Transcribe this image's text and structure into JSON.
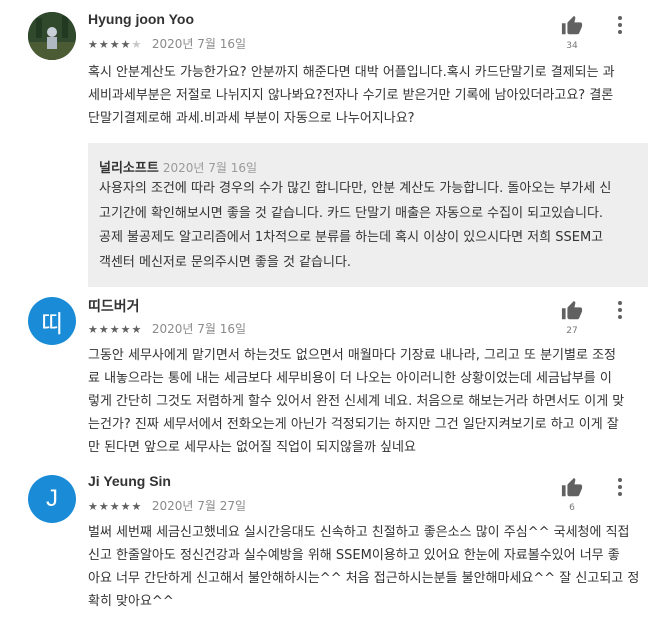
{
  "reviews": [
    {
      "author": "Hyung joon Yoo",
      "rating": 4,
      "date": "2020년 7월 16일",
      "likes": "34",
      "avatar_type": "photo",
      "body_lines": [
        "혹시 안분계산도 가능한가요? 안분까지 해준다면 대박 어플입니다.혹시 카드단말기로 결제되는 과",
        "세비과세부분은 저절로 나뉘지지 않나봐요?전자나 수기로 받은거만 기록에 남아있더라고요? 결론",
        "단말기결제로해 과세.비과세 부분이 자동으로 나누어지나요?"
      ],
      "reply": {
        "author": "널리소프트",
        "date": "2020년 7월 16일",
        "lines": [
          "사용자의 조건에 따라 경우의 수가 많긴 합니다만, 안분 계산도 가능합니다. 돌아오는 부가세 신",
          "고기간에 확인해보시면 좋을 것 같습니다. 카드 단말기 매출은 자동으로 수집이 되고있습니다.",
          "공제 불공제도 알고리즘에서 1차적으로 분류를 하는데 혹시 이상이 있으시다면 저희 SSEM고",
          "객센터 메신저로 문의주시면 좋을 것 같습니다."
        ]
      }
    },
    {
      "author": "띠드버거",
      "rating": 5,
      "date": "2020년 7월 16일",
      "likes": "27",
      "avatar_type": "letter",
      "avatar_letter": "띠",
      "body_lines": [
        "그동안 세무사에게 맡기면서 하는것도 없으면서 매월마다 기장료 내나라, 그리고 또 분기별로 조정",
        "료 내놓으라는 통에 내는 세금보다 세무비용이 더 나오는 아이러니한 상황이었는데 세금납부를 이",
        "렇게 간단히 그것도 저렴하게 할수 있어서 완전 신세계 네요. 처음으로 해보는거라 하면서도 이게 맞",
        "는건가? 진짜 세무서에서 전화오는게 아닌가 걱정되기는 하지만 그건 일단지켜보기로 하고 이게 잘",
        "만 된다면 앞으로 세무사는 없어질 직업이 되지않을까 싶네요"
      ]
    },
    {
      "author": "Ji Yeung Sin",
      "rating": 5,
      "date": "2020년 7월 27일",
      "likes": "6",
      "avatar_type": "letter",
      "avatar_letter": "J",
      "body_lines": [
        "벌써 세번째 세금신고했네요 실시간응대도 신속하고 친절하고 좋은소스 많이 주심^^ 국세청에 직접",
        "신고 한줄알아도 정신건강과 실수예방을 위해 SSEM이용하고 있어요 한눈에 자료볼수있어 너무 좋",
        "아요 너무 간단하게 신고해서 불안해하시는^^ 처음 접근하시는분들 불안해마세요^^ 잘 신고되고 정",
        "확히 맞아요^^"
      ]
    }
  ],
  "colors": {
    "avatar_blue": "#1a8bd6",
    "reply_bg": "#eeeeee",
    "star": "#616161"
  }
}
